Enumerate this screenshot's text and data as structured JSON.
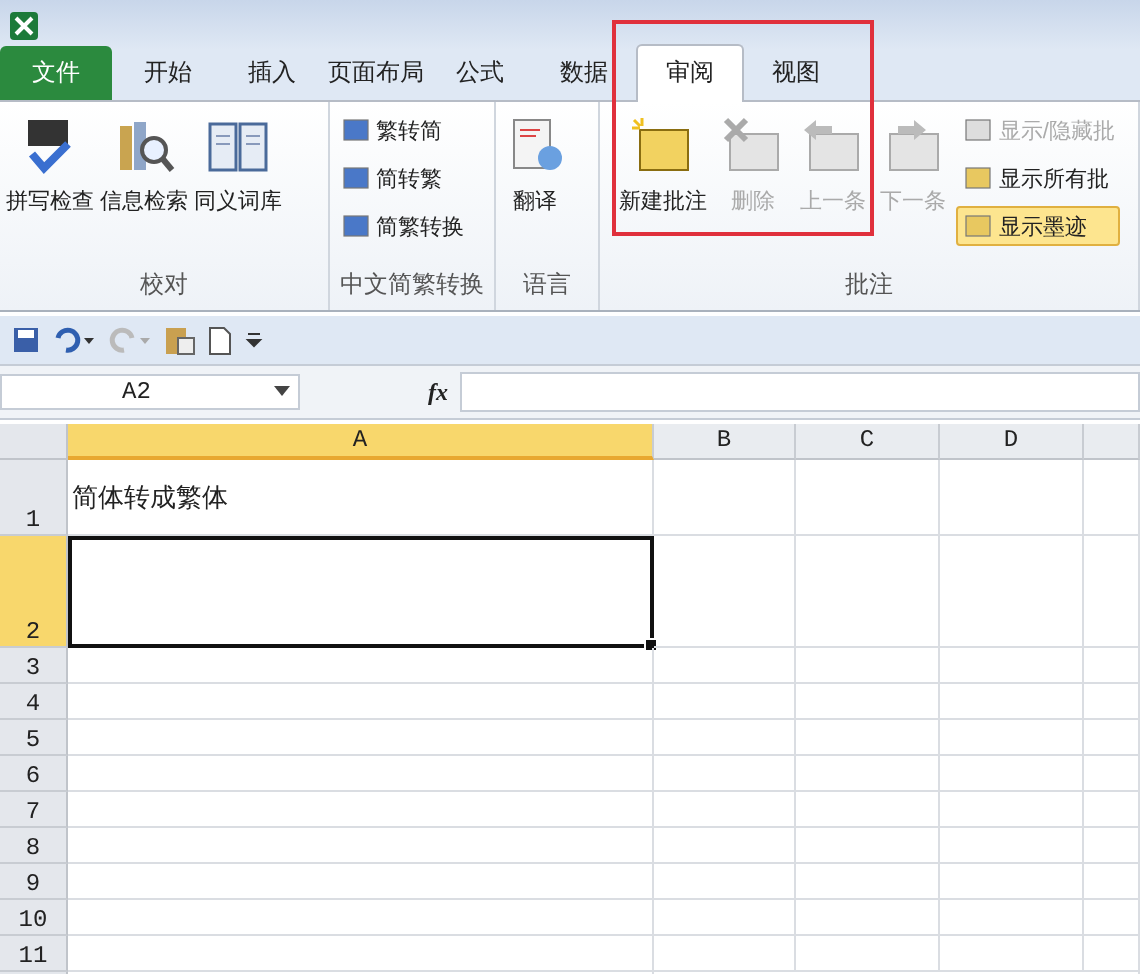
{
  "tabs": [
    {
      "label": "文件",
      "kind": "file",
      "selected": false
    },
    {
      "label": "开始",
      "kind": "tab",
      "selected": false
    },
    {
      "label": "插入",
      "kind": "tab",
      "selected": false
    },
    {
      "label": "页面布局",
      "kind": "tab",
      "selected": false
    },
    {
      "label": "公式",
      "kind": "tab",
      "selected": false
    },
    {
      "label": "数据",
      "kind": "tab",
      "selected": false
    },
    {
      "label": "审阅",
      "kind": "tab",
      "selected": true
    },
    {
      "label": "视图",
      "kind": "tab",
      "selected": false
    }
  ],
  "ribbon": {
    "groups": [
      {
        "label": "校对",
        "buttons": [
          {
            "label": "拼写检查",
            "kind": "large",
            "disabled": false,
            "on": false
          },
          {
            "label": "信息检索",
            "kind": "large",
            "disabled": false,
            "on": false
          },
          {
            "label": "同义词库",
            "kind": "large",
            "disabled": false,
            "on": false
          }
        ]
      },
      {
        "label": "中文简繁转换",
        "buttons": [
          {
            "label": "繁转简",
            "kind": "small",
            "disabled": false,
            "on": false
          },
          {
            "label": "简转繁",
            "kind": "small",
            "disabled": false,
            "on": false
          },
          {
            "label": "简繁转换",
            "kind": "small",
            "disabled": false,
            "on": false
          }
        ]
      },
      {
        "label": "语言",
        "buttons": [
          {
            "label": "翻译",
            "kind": "large",
            "disabled": false,
            "on": false
          }
        ]
      },
      {
        "label": "批注",
        "buttons": [
          {
            "label": "新建批注",
            "kind": "large",
            "disabled": false,
            "on": false
          },
          {
            "label": "删除",
            "kind": "large",
            "disabled": true,
            "on": false
          },
          {
            "label": "上一条",
            "kind": "large",
            "disabled": true,
            "on": false
          },
          {
            "label": "下一条",
            "kind": "large",
            "disabled": true,
            "on": false
          },
          {
            "label": "显示/隐藏批",
            "kind": "small",
            "disabled": true,
            "on": false
          },
          {
            "label": "显示所有批",
            "kind": "small",
            "disabled": false,
            "on": false
          },
          {
            "label": "显示墨迹",
            "kind": "small",
            "disabled": false,
            "on": true
          }
        ]
      }
    ]
  },
  "formula_bar": {
    "name_box": "A2",
    "fx": "fx"
  },
  "sheet": {
    "columns": [
      {
        "label": "A",
        "selected": true
      },
      {
        "label": "B",
        "selected": false
      },
      {
        "label": "C",
        "selected": false
      },
      {
        "label": "D",
        "selected": false
      }
    ],
    "rows": [
      {
        "label": "1",
        "selected": false,
        "cells": [
          "简体转成繁体"
        ]
      },
      {
        "label": "2",
        "selected": true,
        "cells": []
      },
      {
        "label": "3",
        "selected": false,
        "cells": []
      },
      {
        "label": "4",
        "selected": false,
        "cells": []
      },
      {
        "label": "5",
        "selected": false,
        "cells": []
      },
      {
        "label": "6",
        "selected": false,
        "cells": []
      },
      {
        "label": "7",
        "selected": false,
        "cells": []
      },
      {
        "label": "8",
        "selected": false,
        "cells": []
      },
      {
        "label": "9",
        "selected": false,
        "cells": []
      },
      {
        "label": "10",
        "selected": false,
        "cells": []
      },
      {
        "label": "11",
        "selected": false,
        "cells": []
      }
    ]
  }
}
